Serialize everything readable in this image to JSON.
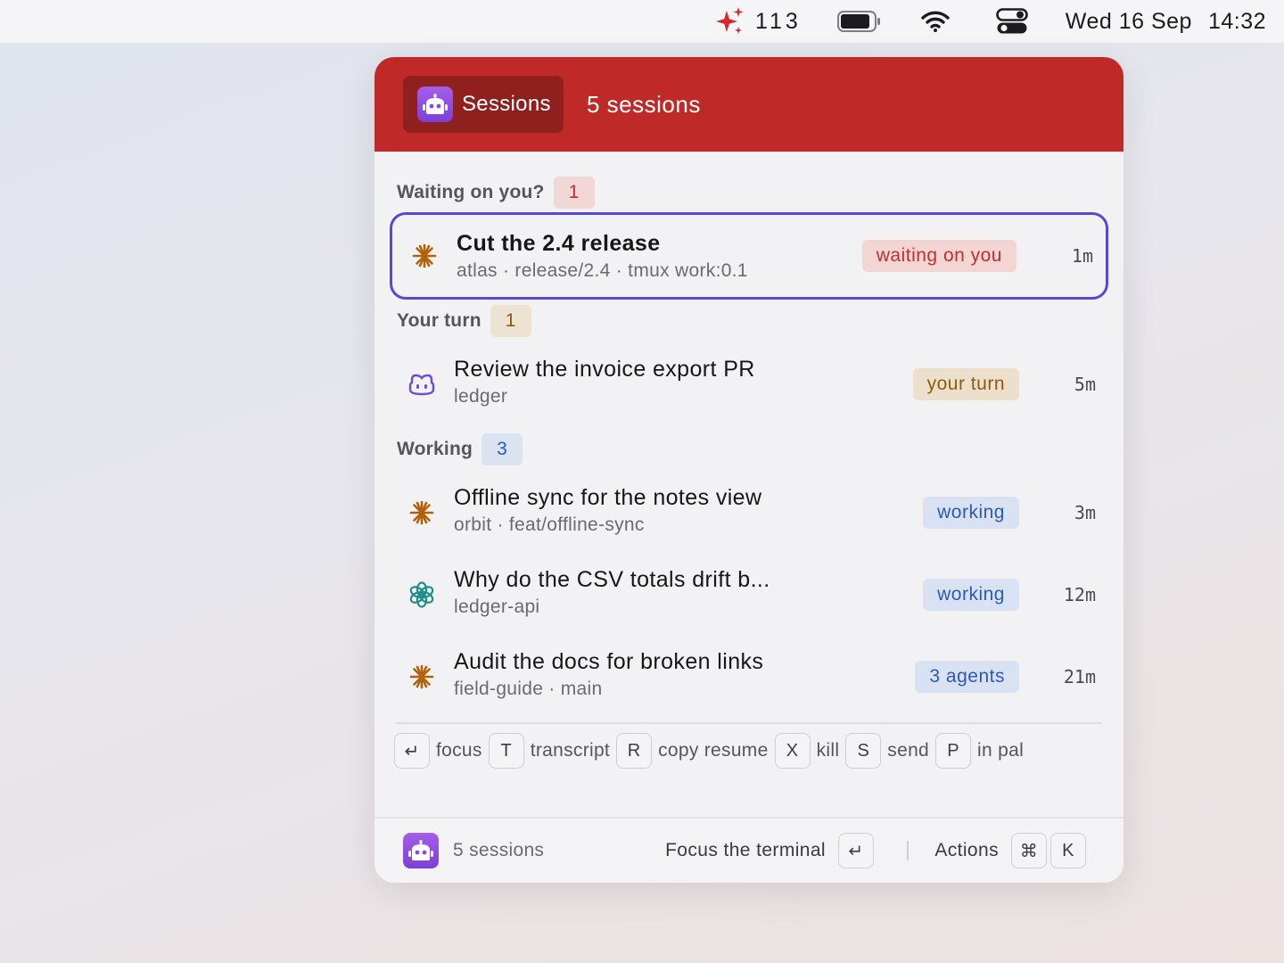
{
  "menubar": {
    "badge_count": "113",
    "date": "Wed 16 Sep",
    "time": "14:32",
    "icons": [
      "sparkles-icon",
      "battery-icon",
      "wifi-icon",
      "control-center-icon"
    ]
  },
  "panel": {
    "tab_label": "Sessions",
    "header_count": "5 sessions",
    "accent_color": "#bf2a28",
    "app_icon": "robot-icon"
  },
  "sections": {
    "waiting": {
      "title": "Waiting on you?",
      "count": "1"
    },
    "your_turn": {
      "title": "Your turn",
      "count": "1"
    },
    "working": {
      "title": "Working",
      "count": "3"
    }
  },
  "sessions": [
    {
      "icon": "claude-asterisk-icon",
      "title": "Cut the 2.4 release",
      "subtitle": "atlas · release/2.4 · tmux work:0.1",
      "status": "waiting on you",
      "age": "1m",
      "selected": true
    },
    {
      "icon": "copilot-icon",
      "title": "Review the invoice export PR",
      "subtitle": "ledger",
      "status": "your turn",
      "age": "5m"
    },
    {
      "icon": "claude-asterisk-icon",
      "title": "Offline sync for the notes view",
      "subtitle": "orbit · feat/offline-sync",
      "status": "working",
      "age": "3m"
    },
    {
      "icon": "openai-icon",
      "title": "Why do the CSV totals drift b...",
      "subtitle": "ledger-api",
      "status": "working",
      "age": "12m"
    },
    {
      "icon": "claude-asterisk-icon",
      "title": "Audit the docs for broken links",
      "subtitle": "field-guide · main",
      "status": "3 agents",
      "age": "21m"
    }
  ],
  "shortcuts": [
    {
      "key": "↵",
      "label": "focus"
    },
    {
      "key": "T",
      "label": "transcript"
    },
    {
      "key": "R",
      "label": "copy resume"
    },
    {
      "key": "X",
      "label": "kill"
    },
    {
      "key": "S",
      "label": "send"
    },
    {
      "key": "P",
      "label": "in pal"
    }
  ],
  "footer": {
    "count": "5 sessions",
    "primary_action": "Focus the terminal",
    "primary_key": "↵",
    "actions_label": "Actions",
    "actions_keys": [
      "⌘",
      "K"
    ]
  }
}
